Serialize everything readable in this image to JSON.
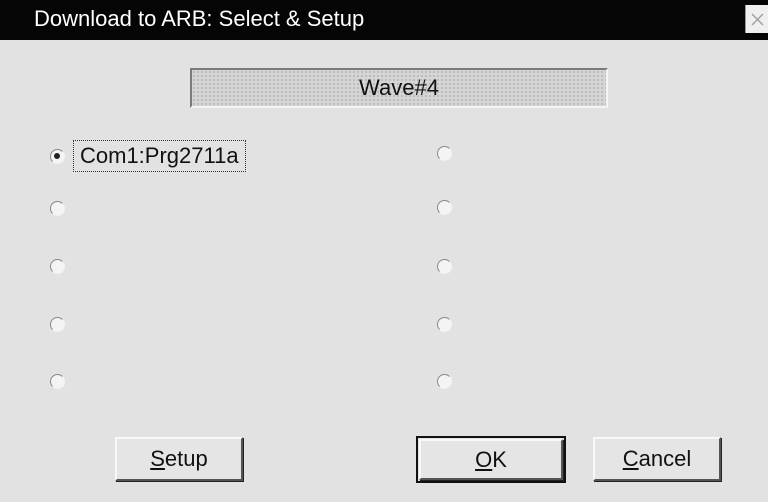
{
  "window": {
    "title": "Download to ARB: Select & Setup"
  },
  "wave_field": {
    "value": "Wave#4"
  },
  "radios": {
    "left": [
      {
        "label": "Com1:Prg2711a",
        "checked": true
      },
      {
        "label": "",
        "checked": false
      },
      {
        "label": "",
        "checked": false
      },
      {
        "label": "",
        "checked": false
      },
      {
        "label": "",
        "checked": false
      }
    ],
    "right": [
      {
        "label": "",
        "checked": false
      },
      {
        "label": "",
        "checked": false
      },
      {
        "label": "",
        "checked": false
      },
      {
        "label": "",
        "checked": false
      },
      {
        "label": "",
        "checked": false
      }
    ]
  },
  "buttons": {
    "setup": {
      "accel": "S",
      "rest": "etup"
    },
    "ok": {
      "accel": "O",
      "rest": "K"
    },
    "cancel": {
      "accel": "C",
      "rest": "ancel"
    }
  },
  "icons": {
    "close": "close-icon",
    "radio": "radio-button-icon"
  }
}
